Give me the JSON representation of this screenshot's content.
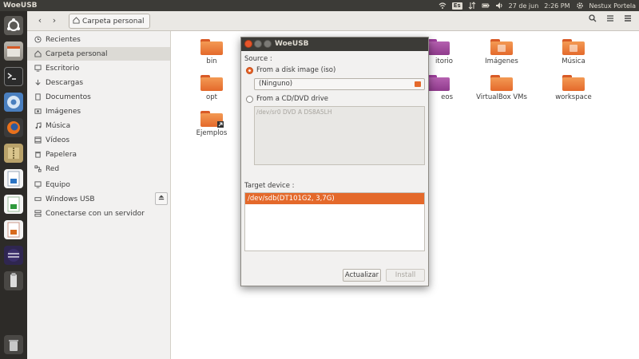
{
  "top_panel": {
    "app_title": "WoeUSB",
    "keyboard_layout": "Es",
    "date": "27 de jun",
    "time": "2:26 PM",
    "user": "Nestux Portela"
  },
  "launcher": {
    "items": [
      "ubuntu-dash",
      "files",
      "terminal",
      "chromium",
      "firefox",
      "archive-manager",
      "libreoffice-writer",
      "libreoffice-calc",
      "libreoffice-impress",
      "eclipse",
      "usb-drive",
      "trash"
    ]
  },
  "file_manager": {
    "header": {
      "back": "‹",
      "forward": "›",
      "breadcrumb": "Carpeta personal"
    },
    "sidebar": {
      "items": [
        {
          "label": "Recientes",
          "icon": "clock-icon"
        },
        {
          "label": "Carpeta personal",
          "icon": "home-icon",
          "selected": true
        },
        {
          "label": "Escritorio",
          "icon": "desktop-icon"
        },
        {
          "label": "Descargas",
          "icon": "download-icon"
        },
        {
          "label": "Documentos",
          "icon": "document-icon"
        },
        {
          "label": "Imágenes",
          "icon": "image-icon"
        },
        {
          "label": "Música",
          "icon": "music-icon"
        },
        {
          "label": "Vídeos",
          "icon": "video-icon"
        },
        {
          "label": "Papelera",
          "icon": "trash-icon"
        },
        {
          "label": "Red",
          "icon": "network-icon"
        }
      ],
      "devices": [
        {
          "label": "Equipo",
          "icon": "computer-icon"
        },
        {
          "label": "Windows USB",
          "icon": "drive-icon"
        },
        {
          "label": "Conectarse con un servidor",
          "icon": "server-icon"
        }
      ]
    },
    "files": [
      {
        "label": "bin"
      },
      {
        "label": "opt"
      },
      {
        "label": "Ejemplos"
      },
      {
        "label": "itorio"
      },
      {
        "label": "eos"
      },
      {
        "label": "Imágenes"
      },
      {
        "label": "VirtualBox VMs"
      },
      {
        "label": "Música"
      },
      {
        "label": "workspace"
      }
    ]
  },
  "dialog": {
    "title": "WoeUSB",
    "source_label": "Source :",
    "iso_option": "From a disk image (iso)",
    "iso_value": "(Ninguno)",
    "cd_option": "From a CD/DVD drive",
    "cd_item": "/dev/sr0  DVD A  DS8A5LH",
    "target_label": "Target device :",
    "target_item": "/dev/sdb(DT101G2,  3,7G)",
    "refresh_button": "Actualizar",
    "install_button": "Install"
  },
  "colors": {
    "accent": "#e4692b",
    "panel": "#3c3b37",
    "launcher": "#2d2b28"
  }
}
